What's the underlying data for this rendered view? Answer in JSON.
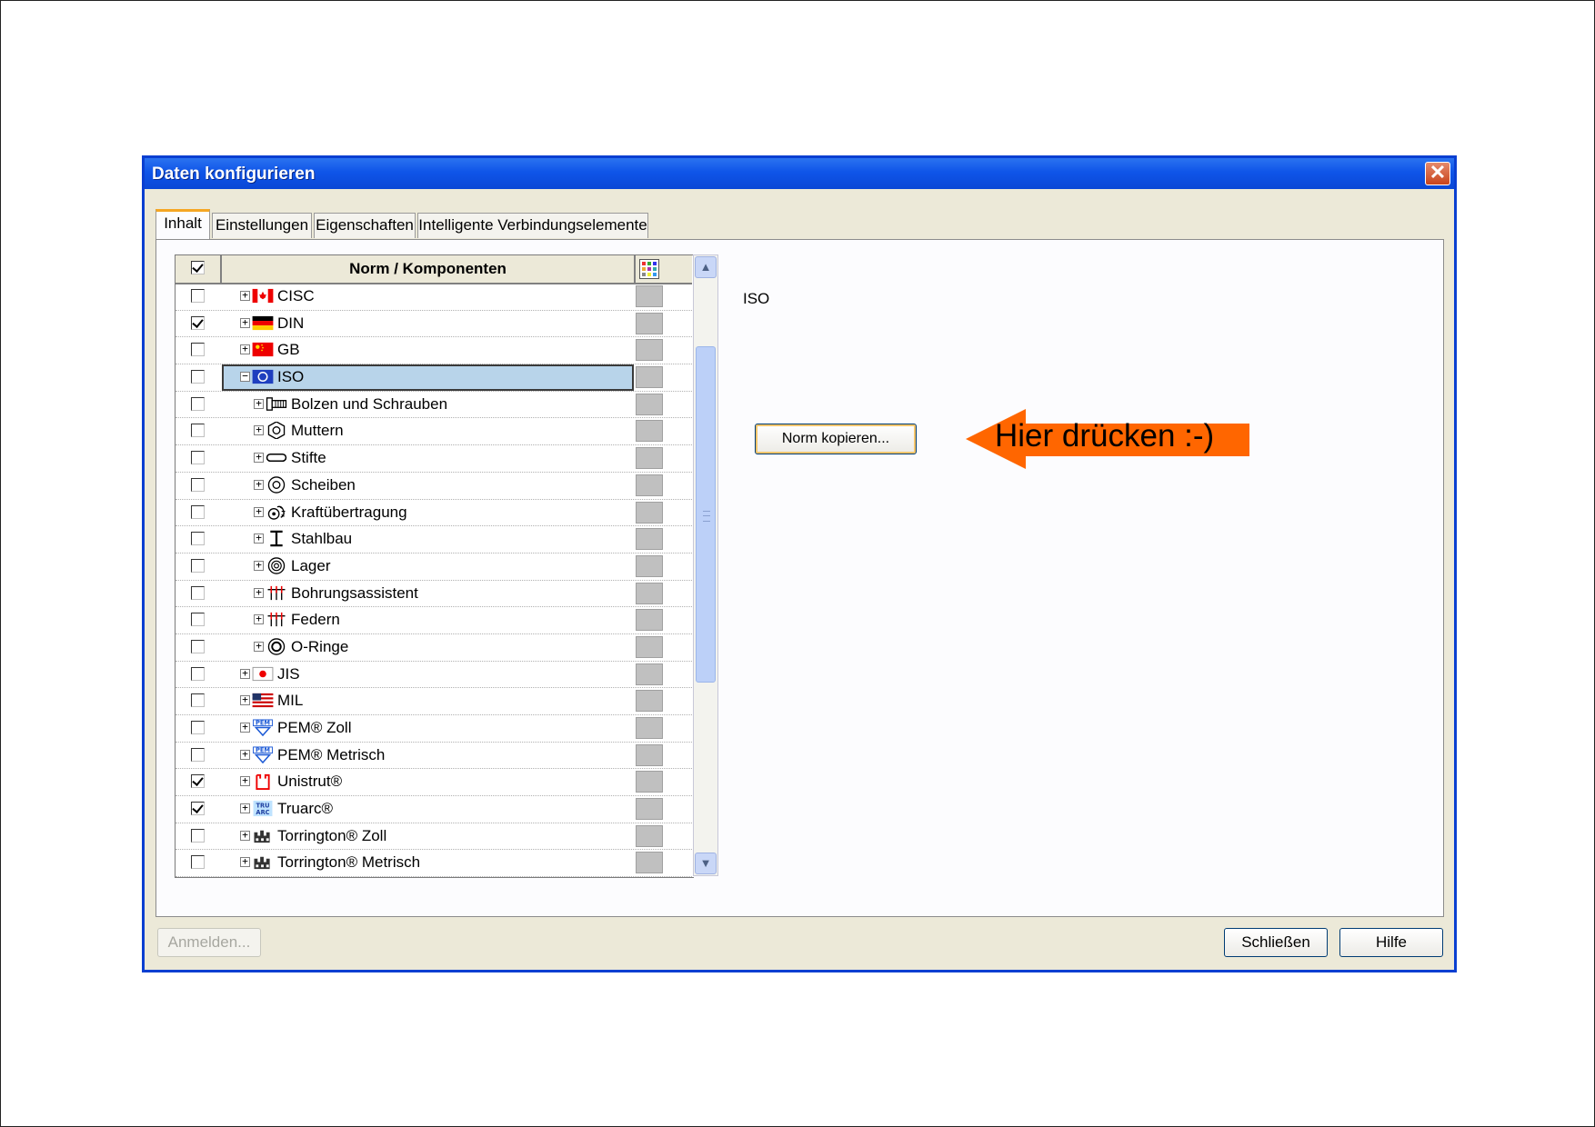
{
  "dialog": {
    "title": "Daten konfigurieren",
    "close_symbol": "✕"
  },
  "tabs": [
    {
      "label": "Inhalt",
      "active": true
    },
    {
      "label": "Einstellungen",
      "active": false
    },
    {
      "label": "Eigenschaften",
      "active": false
    },
    {
      "label": "Intelligente Verbindungselemente",
      "active": false
    }
  ],
  "tree": {
    "header": "Norm / Komponenten",
    "header_checked": true,
    "rows": [
      {
        "label": "CISC",
        "checked": false,
        "level": 0,
        "expander": "+",
        "icon": "canada-flag-icon"
      },
      {
        "label": "DIN",
        "checked": true,
        "level": 0,
        "expander": "+",
        "icon": "germany-flag-icon"
      },
      {
        "label": "GB",
        "checked": false,
        "level": 0,
        "expander": "+",
        "icon": "china-flag-icon"
      },
      {
        "label": "ISO",
        "checked": false,
        "level": 0,
        "expander": "−",
        "icon": "iso-flag-icon",
        "selected": true
      },
      {
        "label": "Bolzen und Schrauben",
        "checked": false,
        "level": 1,
        "expander": "+",
        "icon": "bolt-icon"
      },
      {
        "label": "Muttern",
        "checked": false,
        "level": 1,
        "expander": "+",
        "icon": "nut-icon"
      },
      {
        "label": "Stifte",
        "checked": false,
        "level": 1,
        "expander": "+",
        "icon": "pin-icon"
      },
      {
        "label": "Scheiben",
        "checked": false,
        "level": 1,
        "expander": "+",
        "icon": "washer-icon"
      },
      {
        "label": "Kraftübertragung",
        "checked": false,
        "level": 1,
        "expander": "+",
        "icon": "gear-icon"
      },
      {
        "label": "Stahlbau",
        "checked": false,
        "level": 1,
        "expander": "+",
        "icon": "i-beam-icon"
      },
      {
        "label": "Lager",
        "checked": false,
        "level": 1,
        "expander": "+",
        "icon": "bearing-icon"
      },
      {
        "label": "Bohrungsassistent",
        "checked": false,
        "level": 1,
        "expander": "+",
        "icon": "hole-wizard-icon"
      },
      {
        "label": "Federn",
        "checked": false,
        "level": 1,
        "expander": "+",
        "icon": "spring-icon"
      },
      {
        "label": "O-Ringe",
        "checked": false,
        "level": 1,
        "expander": "+",
        "icon": "o-ring-icon"
      },
      {
        "label": "JIS",
        "checked": false,
        "level": 0,
        "expander": "+",
        "icon": "japan-flag-icon"
      },
      {
        "label": "MIL",
        "checked": false,
        "level": 0,
        "expander": "+",
        "icon": "usa-flag-icon"
      },
      {
        "label": "PEM® Zoll",
        "checked": false,
        "level": 0,
        "expander": "+",
        "icon": "pem-logo-icon"
      },
      {
        "label": "PEM® Metrisch",
        "checked": false,
        "level": 0,
        "expander": "+",
        "icon": "pem-logo-icon"
      },
      {
        "label": "Unistrut®",
        "checked": true,
        "level": 0,
        "expander": "+",
        "icon": "unistrut-logo-icon"
      },
      {
        "label": "Truarc®",
        "checked": true,
        "level": 0,
        "expander": "+",
        "icon": "truarc-logo-icon"
      },
      {
        "label": "Torrington® Zoll",
        "checked": false,
        "level": 0,
        "expander": "+",
        "icon": "torrington-logo-icon"
      },
      {
        "label": "Torrington® Metrisch",
        "checked": false,
        "level": 0,
        "expander": "+",
        "icon": "torrington-logo-icon"
      }
    ]
  },
  "detail": {
    "selected_label": "ISO",
    "copy_button": "Norm kopieren..."
  },
  "callout": {
    "text": "Hier drücken :-)"
  },
  "footer": {
    "login_button": "Anmelden...",
    "close_button": "Schließen",
    "help_button": "Hilfe"
  },
  "colors": {
    "titlebar": "#0f55e8",
    "callout_arrow": "#ff6600",
    "selection": "#b8d4ea",
    "tab_accent": "#f5a623"
  }
}
